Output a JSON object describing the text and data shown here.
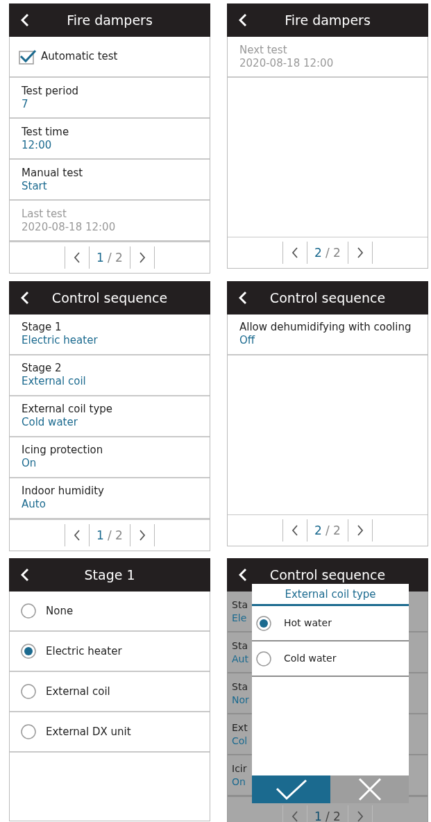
{
  "panels": [
    {
      "kind": "list",
      "title": "Fire dampers",
      "items": [
        {
          "kind": "checkbox",
          "label": "Automatic test",
          "checked": true
        },
        {
          "kind": "setting",
          "label": "Test period",
          "value": "7"
        },
        {
          "kind": "setting",
          "label": "Test time",
          "value": "12:00"
        },
        {
          "kind": "setting",
          "label": "Manual test",
          "value": "Start"
        },
        {
          "kind": "info",
          "label": "Last test",
          "value": "2020-08-18 12:00"
        }
      ],
      "pager": {
        "current": "1",
        "rest": "/ 2"
      }
    },
    {
      "kind": "list",
      "title": "Fire dampers",
      "items": [
        {
          "kind": "info",
          "label": "Next test",
          "value": "2020-08-18 12:00"
        }
      ],
      "pager": {
        "current": "2",
        "rest": "/ 2"
      }
    },
    {
      "kind": "list",
      "title": "Control sequence",
      "items": [
        {
          "kind": "setting",
          "label": "Stage 1",
          "value": "Electric heater"
        },
        {
          "kind": "setting",
          "label": "Stage 2",
          "value": "External coil"
        },
        {
          "kind": "setting",
          "label": "External coil type",
          "value": "Cold water"
        },
        {
          "kind": "setting",
          "label": "Icing protection",
          "value": "On"
        },
        {
          "kind": "setting",
          "label": "Indoor humidity",
          "value": "Auto"
        }
      ],
      "pager": {
        "current": "1",
        "rest": "/ 2"
      }
    },
    {
      "kind": "list",
      "title": "Control sequence",
      "items": [
        {
          "kind": "setting",
          "label": "Allow dehumidifying with cooling",
          "value": "Off"
        }
      ],
      "pager": {
        "current": "2",
        "rest": "/ 2"
      }
    },
    {
      "kind": "radio",
      "title": "Stage 1",
      "options": [
        {
          "label": "None",
          "selected": false
        },
        {
          "label": "Electric heater",
          "selected": true
        },
        {
          "label": "External coil",
          "selected": false
        },
        {
          "label": "External DX unit",
          "selected": false
        }
      ]
    },
    {
      "kind": "dialog",
      "title": "Control sequence",
      "items": [
        {
          "kind": "setting",
          "label": "Sta",
          "value": "Ele"
        },
        {
          "kind": "setting",
          "label": "Sta",
          "value": "Aut"
        },
        {
          "kind": "setting",
          "label": "Sta",
          "value": "Nor"
        },
        {
          "kind": "setting",
          "label": "Ext",
          "value": "Col"
        },
        {
          "kind": "setting",
          "label": "Icir",
          "value": "On"
        }
      ],
      "pager": {
        "current": "1",
        "rest": "/ 2"
      },
      "dialog": {
        "title": "External coil type",
        "options": [
          {
            "label": "Hot water",
            "selected": true
          },
          {
            "label": "Cold water",
            "selected": false
          }
        ]
      }
    }
  ]
}
